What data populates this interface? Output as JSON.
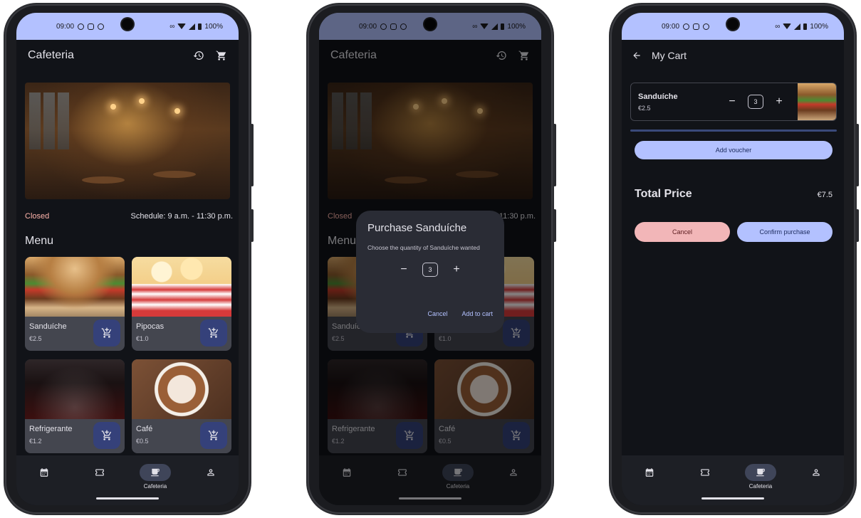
{
  "status": {
    "time": "09:00",
    "battery": "100%"
  },
  "app": {
    "title": "Cafeteria"
  },
  "hero": {
    "image": "cafeteria-interior-photo"
  },
  "info": {
    "closed": "Closed",
    "schedule": "Schedule: 9 a.m. - 11:30 p.m."
  },
  "menu": {
    "title": "Menu",
    "items": [
      {
        "name": "Sanduíche",
        "price": "€2.5",
        "image": "sandwich-photo"
      },
      {
        "name": "Pipocas",
        "price": "€1.0",
        "image": "popcorn-photo"
      },
      {
        "name": "Refrigerante",
        "price": "€1.2",
        "image": "soda-photo"
      },
      {
        "name": "Café",
        "price": "€0.5",
        "image": "coffee-photo"
      }
    ]
  },
  "nav": {
    "cafeteria_label": "Cafeteria"
  },
  "dialog": {
    "title": "Purchase Sanduíche",
    "subtitle": "Choose the quantity of Sanduíche wanted",
    "quantity": "3",
    "cancel": "Cancel",
    "add": "Add to cart"
  },
  "cart": {
    "title": "My Cart",
    "item": {
      "name": "Sanduíche",
      "price": "€2.5",
      "quantity": "3"
    },
    "voucher": "Add voucher",
    "total_label": "Total Price",
    "total_value": "€7.5",
    "cancel": "Cancel",
    "confirm": "Confirm purchase"
  },
  "colors": {
    "accent": "#b3c1ff",
    "closed": "#ffb4ab",
    "cancel": "#f2b6b8",
    "background": "#111318"
  }
}
